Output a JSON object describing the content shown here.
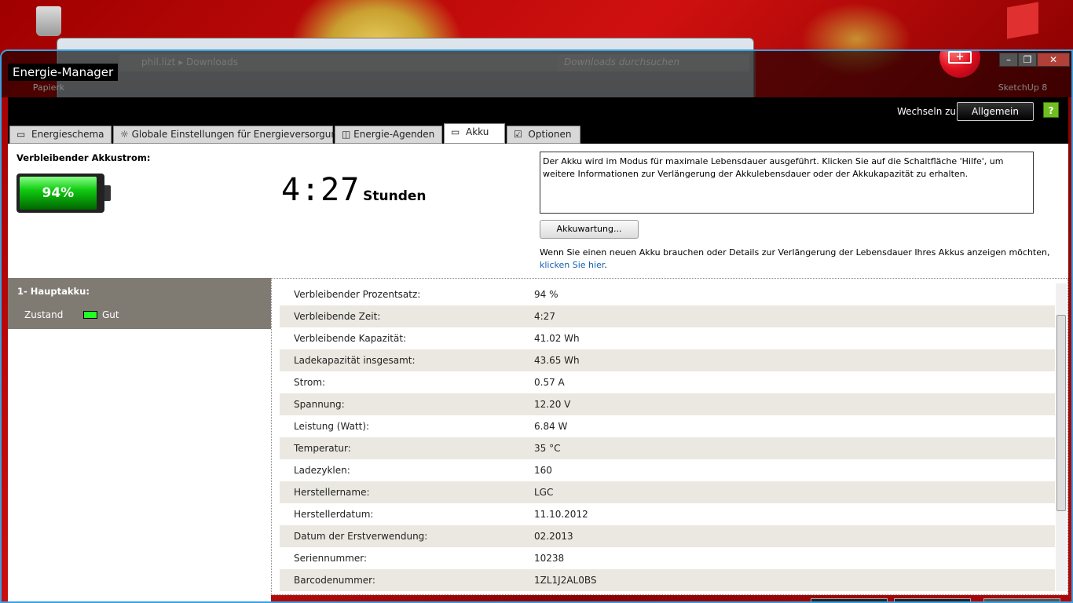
{
  "desktop": {
    "icons": [
      {
        "label": "Papierk"
      },
      {
        "label": "SketchUp 8"
      }
    ]
  },
  "explorer": {
    "breadcrumb": [
      "phil.lizt",
      "Downloads"
    ],
    "search_placeholder": "Downloads durchsuchen"
  },
  "window": {
    "title": "Energie-Manager",
    "minimize": "–",
    "maximize": "❐",
    "close": "✕"
  },
  "header": {
    "switch_label": "Wechseln zu:",
    "switch_button": "Allgemein",
    "help": "?"
  },
  "tabs": [
    {
      "label": "Energieschema",
      "icon": "page-icon"
    },
    {
      "label": "Globale Einstellungen für Energieversorgung",
      "icon": "gear-icon"
    },
    {
      "label": "Energie-Agenden",
      "icon": "clock-icon"
    },
    {
      "label": "Akku",
      "icon": "battery-icon",
      "active": true
    },
    {
      "label": "Optionen",
      "icon": "checkbox-icon"
    }
  ],
  "battery": {
    "title": "Verbleibender Akkustrom:",
    "percent_label": "94%",
    "percent": 94,
    "time": "4:27",
    "time_unit": "Stunden",
    "fill_color": "#20c020"
  },
  "info": {
    "text": "Der Akku wird im Modus für maximale Lebensdauer ausgeführt. Klicken Sie auf die Schaltfläche 'Hilfe', um weitere Informationen zur Verlängerung der Akkulebensdauer oder der Akkukapazität zu erhalten.",
    "button": "Akkuwartung...",
    "note": "Wenn Sie einen neuen Akku brauchen oder Details zur Verlängerung der Lebensdauer Ihres Akkus anzeigen möchten,",
    "link": "klicken Sie hier",
    "link_suffix": "."
  },
  "sidebar": {
    "title": "1- Hauptakku:",
    "status_label": "Zustand",
    "status_value": "Gut"
  },
  "details": [
    {
      "k": "Verbleibender Prozentsatz:",
      "v": "94 %"
    },
    {
      "k": "Verbleibende Zeit:",
      "v": "4:27"
    },
    {
      "k": "Verbleibende Kapazität:",
      "v": "41.02 Wh"
    },
    {
      "k": "Ladekapazität insgesamt:",
      "v": "43.65 Wh"
    },
    {
      "k": "Strom:",
      "v": "0.57 A"
    },
    {
      "k": "Spannung:",
      "v": "12.20 V"
    },
    {
      "k": "Leistung (Watt):",
      "v": "6.84 W"
    },
    {
      "k": "Temperatur:",
      "v": "35 °C"
    },
    {
      "k": "Ladezyklen:",
      "v": "160"
    },
    {
      "k": "Herstellername:",
      "v": "LGC"
    },
    {
      "k": "Herstellerdatum:",
      "v": "11.10.2012"
    },
    {
      "k": "Datum der Erstverwendung:",
      "v": "02.2013"
    },
    {
      "k": "Seriennummer:",
      "v": "10238"
    },
    {
      "k": "Barcodenummer:",
      "v": "1ZL1J2AL0BS"
    }
  ]
}
